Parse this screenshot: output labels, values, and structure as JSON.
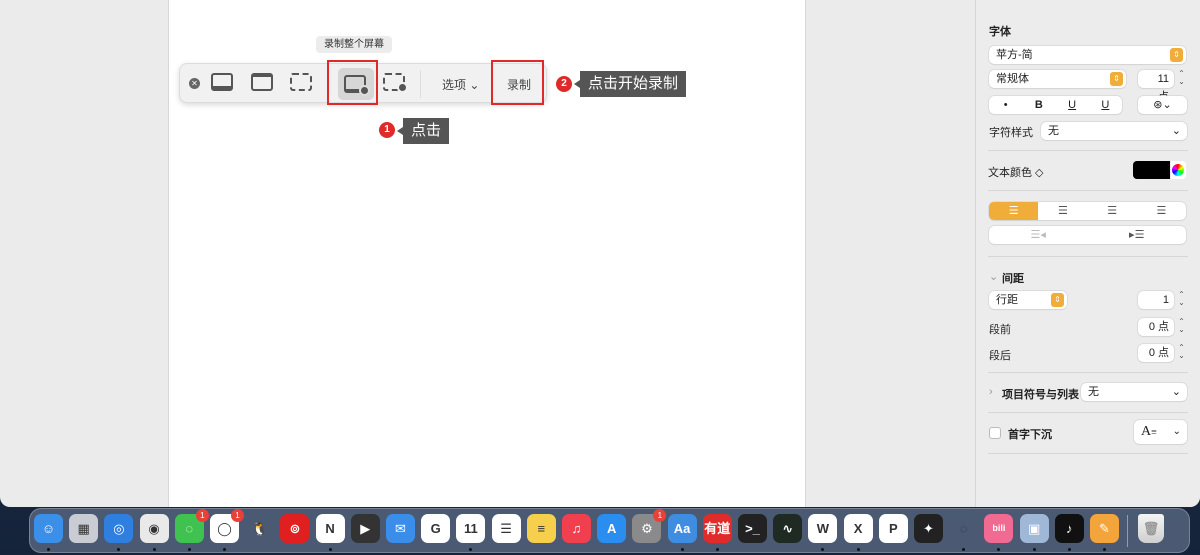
{
  "capture": {
    "tooltip": "录制整个屏幕",
    "options_label": "选项",
    "record_label": "录制",
    "annotations": [
      {
        "num": "1",
        "text": "点击"
      },
      {
        "num": "2",
        "text": "点击开始录制"
      }
    ]
  },
  "sidebar": {
    "font_heading": "字体",
    "font_family": "苹方-简",
    "font_style": "常规体",
    "font_size": "11 点",
    "format_buttons": [
      "•",
      "B",
      "U",
      "U"
    ],
    "char_style_label": "字符样式",
    "char_style_value": "无",
    "text_color_label": "文本颜色 ◇",
    "text_color": "#000000",
    "accent": "#f0ad3a",
    "spacing_heading": "间距",
    "line_spacing_label": "行距",
    "line_spacing_value": "1",
    "before_label": "段前",
    "before_value": "0 点",
    "after_label": "段后",
    "after_value": "0 点",
    "bullets_label": "项目符号与列表",
    "bullets_value": "无",
    "dropcap_label": "首字下沉",
    "dropcap_glyph": "A"
  },
  "dock": [
    {
      "name": "finder",
      "color": "#3b8fe8",
      "glyph": "☺",
      "dot": true
    },
    {
      "name": "launchpad",
      "color": "#c9ccd3",
      "glyph": "▦",
      "dot": false
    },
    {
      "name": "safari",
      "color": "#2f7fe0",
      "glyph": "◎",
      "dot": true
    },
    {
      "name": "chrome",
      "color": "#e9e9e9",
      "glyph": "◉",
      "dot": true
    },
    {
      "name": "wechat",
      "color": "#3fc24f",
      "glyph": "◌",
      "badge": "1",
      "dot": true
    },
    {
      "name": "chat",
      "color": "#ffffff",
      "glyph": "◯",
      "badge": "1",
      "dot": true
    },
    {
      "name": "qq",
      "color": "transparent",
      "glyph": "🐧",
      "dot": false
    },
    {
      "name": "netease-music",
      "color": "#e02020",
      "glyph": "⊚",
      "dot": false
    },
    {
      "name": "notion",
      "color": "#ffffff",
      "glyph": "N",
      "dot": true
    },
    {
      "name": "final-cut",
      "color": "#333333",
      "glyph": "▶",
      "dot": false
    },
    {
      "name": "mail",
      "color": "#3a8de8",
      "glyph": "✉",
      "dot": false
    },
    {
      "name": "wps",
      "color": "#ffffff",
      "glyph": "G",
      "dot": false
    },
    {
      "name": "calendar",
      "color": "#ffffff",
      "glyph": "11",
      "dot": true
    },
    {
      "name": "reminders",
      "color": "#ffffff",
      "glyph": "☰",
      "dot": false
    },
    {
      "name": "notes",
      "color": "#f6d04d",
      "glyph": "≡",
      "dot": false
    },
    {
      "name": "music",
      "color": "#f0404f",
      "glyph": "♫",
      "dot": false
    },
    {
      "name": "app-store",
      "color": "#2a8df0",
      "glyph": "A",
      "dot": false
    },
    {
      "name": "system-preferences",
      "color": "#8a8a8a",
      "glyph": "⚙",
      "badge": "1",
      "dot": false
    },
    {
      "name": "dictionary",
      "color": "#3f8de0",
      "glyph": "Aa",
      "dot": true
    },
    {
      "name": "youdao",
      "color": "#e12a2a",
      "glyph": "有道",
      "dot": true
    },
    {
      "name": "terminal",
      "color": "#222222",
      "glyph": ">_",
      "dot": false
    },
    {
      "name": "activity-monitor",
      "color": "#1e2a22",
      "glyph": "∿",
      "dot": false
    },
    {
      "name": "word",
      "color": "#ffffff",
      "glyph": "W",
      "dot": true
    },
    {
      "name": "excel",
      "color": "#ffffff",
      "glyph": "X",
      "dot": true
    },
    {
      "name": "powerpoint",
      "color": "#ffffff",
      "glyph": "P",
      "dot": false
    },
    {
      "name": "figma",
      "color": "#222222",
      "glyph": "✦",
      "dot": false
    },
    {
      "name": "circle-app",
      "color": "transparent",
      "glyph": "◌",
      "dot": true
    },
    {
      "name": "bilibili",
      "color": "#f06a91",
      "glyph": "bili",
      "dot": true
    },
    {
      "name": "preview",
      "color": "#9fb8d8",
      "glyph": "▣",
      "dot": true
    },
    {
      "name": "tiktok",
      "color": "#111111",
      "glyph": "♪",
      "dot": true
    },
    {
      "name": "pages",
      "color": "#f3a43a",
      "glyph": "✎",
      "dot": true
    }
  ]
}
